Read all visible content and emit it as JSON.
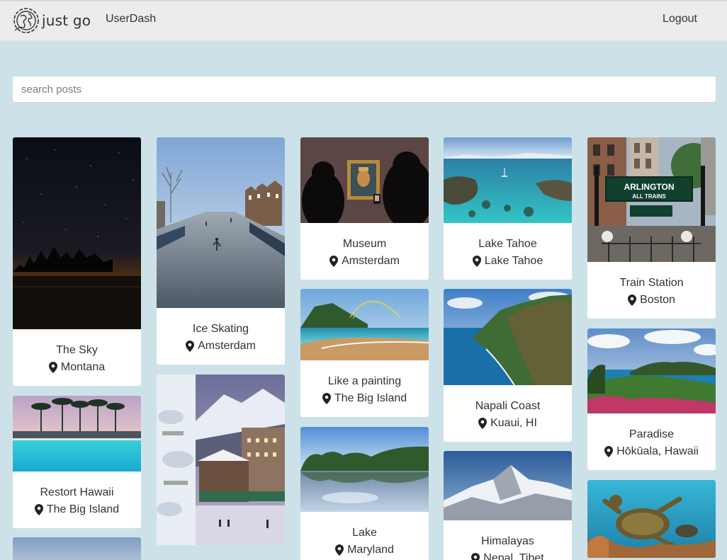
{
  "nav": {
    "brand": "just go",
    "userdash": "UserDash",
    "logout": "Logout"
  },
  "search": {
    "placeholder": "search posts",
    "value": ""
  },
  "posts": [
    {
      "title": "The Sky",
      "location": "Montana"
    },
    {
      "title": "Restort Hawaii",
      "location": "The Big Island"
    },
    {
      "title": "Ice Skating",
      "location": "Amsterdam"
    },
    {
      "title": "Museum",
      "location": "Amsterdam"
    },
    {
      "title": "Like a painting",
      "location": "The Big Island"
    },
    {
      "title": "Lake",
      "location": "Maryland"
    },
    {
      "title": "Lake Tahoe",
      "location": "Lake Tahoe"
    },
    {
      "title": "Napali Coast",
      "location": "Kuaui, HI"
    },
    {
      "title": "Himalayas",
      "location": "Nepal, Tibet"
    },
    {
      "title": "Train Station",
      "location": "Boston"
    },
    {
      "title": "Paradise",
      "location": "Hōkūala, Hawaii"
    }
  ],
  "signage": {
    "line1": "ARLINGTON",
    "line2": "ALL TRAINS"
  },
  "icons": {
    "location": "map-marker-icon",
    "logo": "globe-logo-icon"
  },
  "colors": {
    "page_bg": "#cde2e8",
    "navbar_bg": "#ececec",
    "card_bg": "#ffffff",
    "text": "#333333"
  }
}
